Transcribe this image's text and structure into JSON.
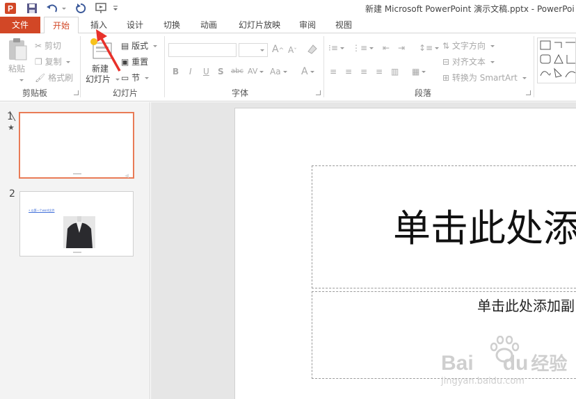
{
  "window": {
    "title": "新建 Microsoft PowerPoint 演示文稿.pptx - PowerPoi",
    "app_icon_letter": "P"
  },
  "tabs": [
    {
      "label": "文件"
    },
    {
      "label": "开始"
    },
    {
      "label": "插入"
    },
    {
      "label": "设计"
    },
    {
      "label": "切换"
    },
    {
      "label": "动画"
    },
    {
      "label": "幻灯片放映"
    },
    {
      "label": "审阅"
    },
    {
      "label": "视图"
    }
  ],
  "ribbon": {
    "clipboard": {
      "paste": "粘贴",
      "cut": "剪切",
      "copy": "复制",
      "format_painter": "格式刷",
      "group_label": "剪贴板"
    },
    "slides": {
      "new_slide_line1": "新建",
      "new_slide_line2": "幻灯片",
      "layout": "版式",
      "reset": "重置",
      "section": "节",
      "group_label": "幻灯片"
    },
    "font": {
      "bold": "B",
      "italic": "I",
      "underline": "U",
      "shadow": "S",
      "strike": "abc",
      "spacing": "AV",
      "case": "Aa",
      "color": "A",
      "grow": "A",
      "shrink": "A",
      "group_label": "字体"
    },
    "paragraph": {
      "text_direction": "文字方向",
      "align_text": "对齐文本",
      "convert_smartart": "转换为 SmartArt",
      "group_label": "段落"
    }
  },
  "thumbnails": [
    {
      "number": "1",
      "star": "★"
    },
    {
      "number": "2",
      "caption": "• 以第一个word文件"
    }
  ],
  "slide": {
    "title_placeholder": "单击此处添",
    "subtitle_placeholder": "单击此处添加副"
  },
  "watermark": {
    "brand": "Bai",
    "brand2": "du",
    "cn": "经验",
    "url": "jingyan.baidu.com"
  },
  "colors": {
    "accent": "#d24726",
    "annotation_arrow": "#e8312a"
  }
}
